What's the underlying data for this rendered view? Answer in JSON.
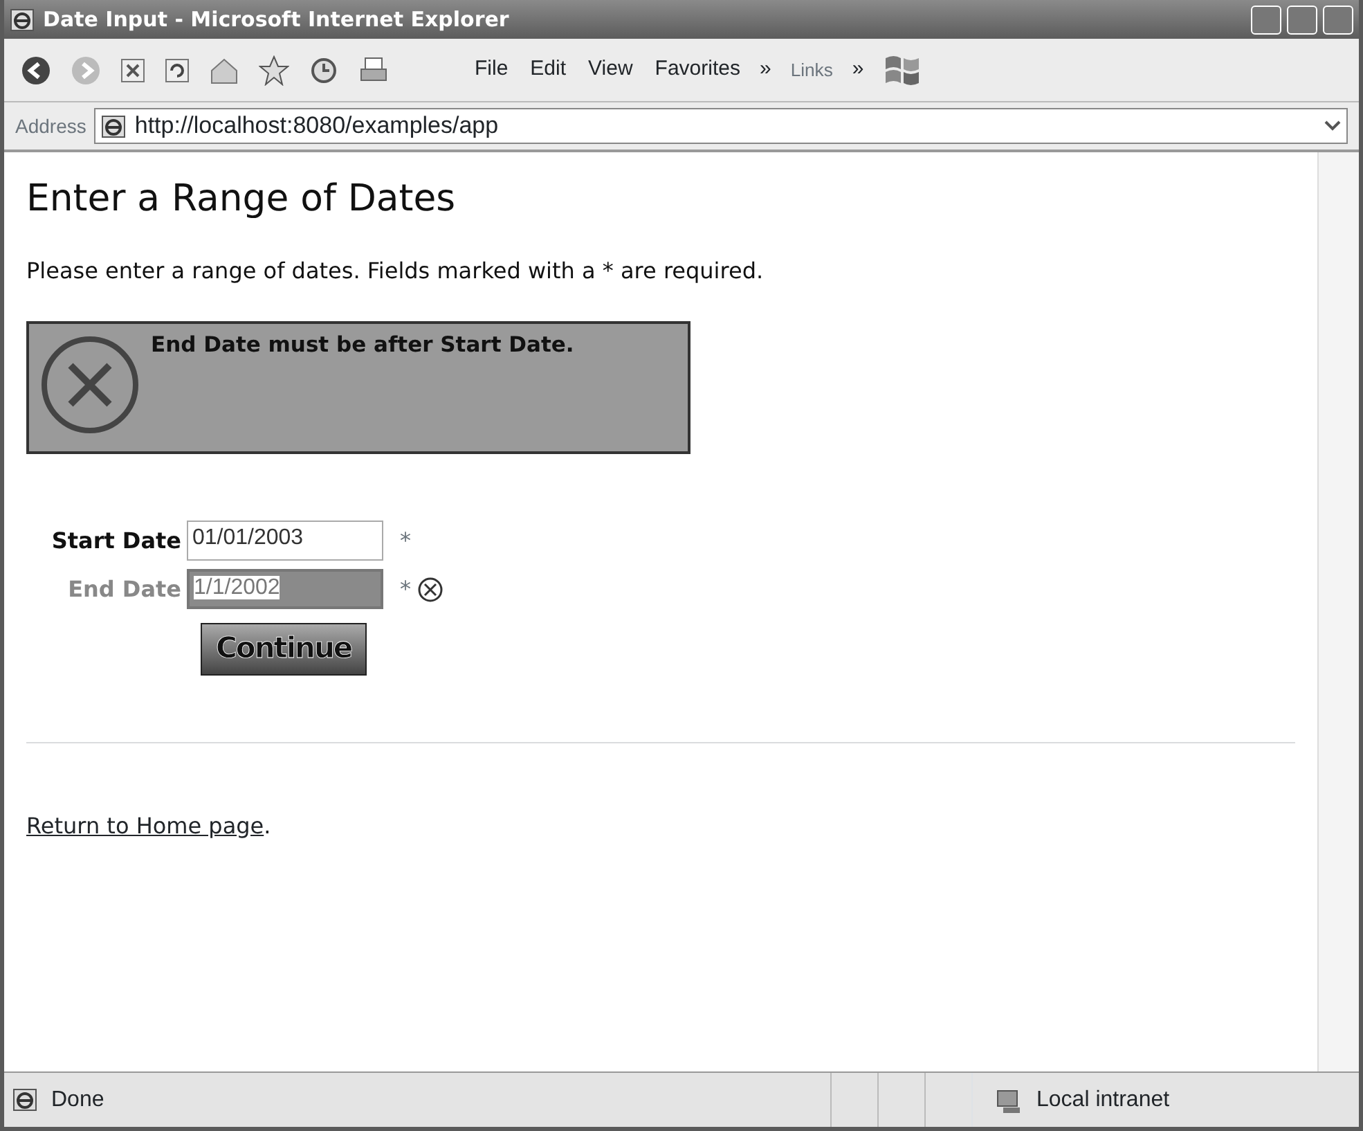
{
  "window": {
    "title": "Date Input - Microsoft Internet Explorer"
  },
  "toolbar": {
    "menu": [
      {
        "label": "File"
      },
      {
        "label": "Edit"
      },
      {
        "label": "View"
      },
      {
        "label": "Favorites"
      }
    ],
    "more": "»",
    "links": "Links",
    "links_more": "»"
  },
  "address": {
    "label": "Address",
    "url": "http://localhost:8080/examples/app"
  },
  "page": {
    "heading": "Enter a Range of Dates",
    "intro": "Please enter a range of dates. Fields marked with a * are required.",
    "error": "End Date must be after Start Date.",
    "fields": [
      {
        "label": "Start Date",
        "value": "01/01/2003",
        "required": "*",
        "invalid": false
      },
      {
        "label": "End Date",
        "value": "1/1/2002",
        "required": "*",
        "invalid": true
      }
    ],
    "button": "Continue",
    "link": "Return to Home page",
    "link_after": "."
  },
  "status_bar": {
    "text": "Done",
    "zone": "Local intranet"
  }
}
